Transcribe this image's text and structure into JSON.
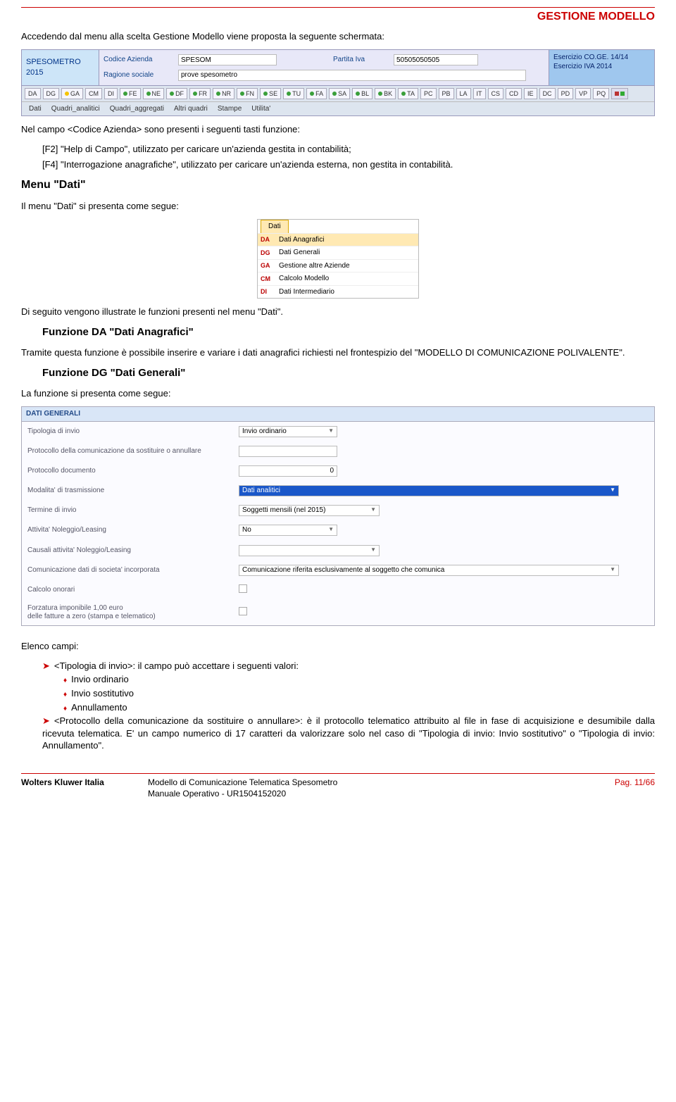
{
  "header": {
    "title": "GESTIONE MODELLO"
  },
  "intro": "Accedendo dal menu alla scelta Gestione Modello viene proposta la seguente schermata:",
  "ss1": {
    "title": "SPESOMETRO 2015",
    "labels": {
      "codice": "Codice Azienda",
      "piva": "Partita Iva",
      "ragione": "Ragione sociale"
    },
    "values": {
      "codice": "SPESOM",
      "piva": "50505050505",
      "ragione": "prove spesometro"
    },
    "ex1": "Esercizio CO.GE. 14/14",
    "ex2": "Esercizio IVA 2014",
    "tabs": [
      "DA",
      "DG",
      "GA",
      "CM",
      "DI",
      "FE",
      "NE",
      "DF",
      "FR",
      "NR",
      "FN",
      "SE",
      "TU",
      "FA",
      "SA",
      "BL",
      "BK",
      "TA",
      "PC",
      "PB",
      "LA",
      "IT",
      "CS",
      "CD",
      "IE",
      "DC",
      "PD",
      "VP",
      "PQ"
    ],
    "tab_dots": {
      "GA": "y",
      "FE": "g",
      "NE": "g",
      "DF": "g",
      "FR": "g",
      "NR": "g",
      "FN": "g",
      "SE": "g",
      "TU": "g",
      "FA": "g",
      "SA": "g",
      "BL": "g",
      "BK": "g",
      "TA": "g"
    },
    "menubar": [
      "Dati",
      "Quadri_analitici",
      "Quadri_aggregati",
      "Altri quadri",
      "Stampe",
      "Utilita'"
    ]
  },
  "para1": "Nel campo <Codice Azienda> sono presenti i seguenti tasti funzione:",
  "para1a": "[F2] \"Help di Campo\", utilizzato per caricare un'azienda gestita in contabilità;",
  "para1b": "[F4] \"Interrogazione anagrafiche\", utilizzato per caricare un'azienda esterna, non gestita in contabilità.",
  "h2_dati": "Menu \"Dati\"",
  "para_dati": "Il menu \"Dati\" si presenta come segue:",
  "ss2": {
    "tab": "Dati",
    "items": [
      {
        "code": "DA",
        "label": "Dati Anagrafici"
      },
      {
        "code": "DG",
        "label": "Dati Generali"
      },
      {
        "code": "GA",
        "label": "Gestione altre Aziende"
      },
      {
        "code": "CM",
        "label": "Calcolo Modello"
      },
      {
        "code": "DI",
        "label": "Dati Intermediario"
      }
    ]
  },
  "para_seguito": "Di seguito vengono illustrate le funzioni presenti nel menu \"Dati\".",
  "h3_da": "Funzione DA \"Dati Anagrafici\"",
  "para_da": "Tramite questa funzione è possibile inserire e variare i dati anagrafici richiesti nel frontespizio del \"MODELLO DI COMUNICAZIONE POLIVALENTE\".",
  "h3_dg": "Funzione DG \"Dati Generali\"",
  "para_dg": "La funzione si presenta come segue:",
  "ss3": {
    "header": "DATI GENERALI",
    "rows": {
      "tipologia": {
        "label": "Tipologia di invio",
        "value": "Invio ordinario"
      },
      "protocollo_sost": {
        "label": "Protocollo della comunicazione da sostituire o annullare",
        "value": ""
      },
      "protocollo_doc": {
        "label": "Protocollo documento",
        "value": "0"
      },
      "modalita": {
        "label": "Modalita' di trasmissione",
        "value": "Dati analitici"
      },
      "termine": {
        "label": "Termine di invio",
        "value": "Soggetti mensili (nel 2015)"
      },
      "attivita": {
        "label": "Attivita' Noleggio/Leasing",
        "value": "No"
      },
      "causali": {
        "label": "Causali attivita' Noleggio/Leasing",
        "value": ""
      },
      "comunicazione": {
        "label": "Comunicazione dati di societa' incorporata",
        "value": "Comunicazione riferita esclusivamente al soggetto che comunica"
      },
      "calcolo": {
        "label": "Calcolo onorari"
      },
      "forzatura": {
        "label": "Forzatura imponibile 1,00 euro\ndelle fatture a zero (stampa e telematico)"
      }
    }
  },
  "elenco": {
    "title": "Elenco campi:",
    "item1": "<Tipologia di invio>: il campo può accettare i seguenti valori:",
    "sub1": "Invio ordinario",
    "sub2": "Invio sostitutivo",
    "sub3": "Annullamento",
    "item2": "<Protocollo della comunicazione da sostituire o annullare>: è il protocollo telematico attribuito al file in fase di acquisizione e desumibile dalla ricevuta telematica. E' un campo numerico di 17 caratteri da valorizzare solo nel caso di \"Tipologia di invio: Invio sostitutivo\" o \"Tipologia di invio: Annullamento\"."
  },
  "footer": {
    "left": "Wolters Kluwer Italia",
    "center1": "Modello di Comunicazione Telematica Spesometro",
    "center2": "Manuale Operativo - UR1504152020",
    "right": "Pag. 11/66"
  }
}
